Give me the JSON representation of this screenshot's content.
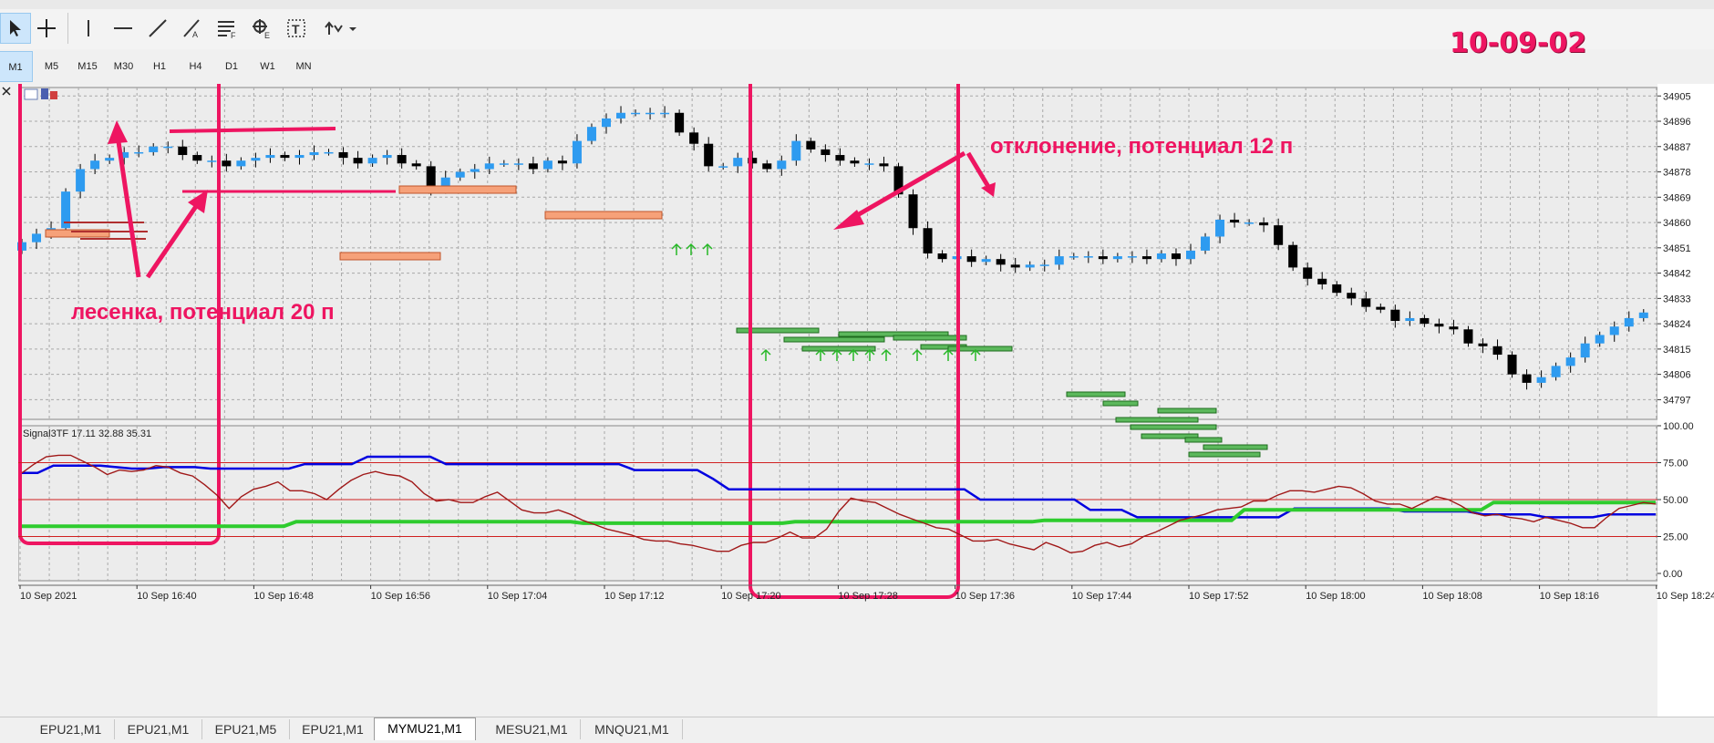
{
  "toolbar": {
    "tools": [
      {
        "icon": "cursor-icon",
        "label": "Cursor"
      },
      {
        "icon": "crosshair-icon",
        "label": "Crosshair"
      },
      {
        "icon": "vertical-line-icon",
        "label": "Vertical Line"
      },
      {
        "icon": "horizontal-line-icon",
        "label": "Horizontal Line"
      },
      {
        "icon": "trendline-icon",
        "label": "Trendline"
      },
      {
        "icon": "trendline-angle-icon",
        "label": "Trendline by Angle"
      },
      {
        "icon": "fibonacci-icon",
        "label": "Fibonacci"
      },
      {
        "icon": "gann-icon",
        "label": "Gann"
      },
      {
        "icon": "text-icon",
        "label": "Text"
      },
      {
        "icon": "arrows-icon",
        "label": "Arrows"
      }
    ]
  },
  "timeframes": [
    "M1",
    "M5",
    "M15",
    "M30",
    "H1",
    "H4",
    "D1",
    "W1",
    "MN"
  ],
  "active_timeframe": "M1",
  "annotation_title": "10-09-02",
  "annotations": {
    "ladder": "лесенка, потенциал 20 п",
    "deviation": "отклонение, потенциал 12 п"
  },
  "tabs": [
    "EPU21,M1",
    "EPU21,M1",
    "EPU21,M5",
    "EPU21,M1",
    "MYMU21,M1",
    "MESU21,M1",
    "MNQU21,M1"
  ],
  "active_tab": "MYMU21,M1",
  "colors": {
    "bull": "#2e9bf0",
    "bear": "#000000",
    "grid": "#a8a8a8",
    "accent": "#ee1561",
    "bg": "#ececec"
  },
  "chart_data": [
    {
      "type": "candlestick",
      "xlabel": "",
      "ylabel": "",
      "x_ticks": [
        "10 Sep 2021",
        "10 Sep 16:40",
        "10 Sep 16:48",
        "10 Sep 16:56",
        "10 Sep 17:04",
        "10 Sep 17:12",
        "10 Sep 17:20",
        "10 Sep 17:28",
        "10 Sep 17:36",
        "10 Sep 17:44",
        "10 Sep 17:52",
        "10 Sep 18:00",
        "10 Sep 18:08",
        "10 Sep 18:16",
        "10 Sep 18:24"
      ],
      "y_ticks": [
        34905,
        34896,
        34887,
        34878,
        34869,
        34860,
        34851,
        34842,
        34833,
        34824,
        34815,
        34806,
        34797
      ],
      "ylim": [
        34790,
        34908
      ],
      "closes": [
        34853,
        34856,
        34858,
        34871,
        34879,
        34882,
        34883,
        34885,
        34885,
        34887,
        34887,
        34884,
        34882,
        34882,
        34880,
        34882,
        34883,
        34884,
        34883,
        34884,
        34885,
        34885,
        34883,
        34881,
        34883,
        34884,
        34881,
        34880,
        34872,
        34876,
        34878,
        34879,
        34881,
        34881,
        34881,
        34879,
        34882,
        34881,
        34889,
        34894,
        34897,
        34899,
        34899,
        34899,
        34899,
        34892,
        34888,
        34880,
        34880,
        34883,
        34881,
        34879,
        34882,
        34889,
        34886,
        34884,
        34882,
        34881,
        34881,
        34880,
        34870,
        34858,
        34849,
        34847,
        34848,
        34846,
        34847,
        34845,
        34844,
        34845,
        34845,
        34848,
        34848,
        34848,
        34847,
        34848,
        34848,
        34847,
        34849,
        34847,
        34850,
        34855,
        34861,
        34860,
        34860,
        34859,
        34852,
        34844,
        34840,
        34838,
        34835,
        34833,
        34830,
        34829,
        34825,
        34826,
        34824,
        34823,
        34822,
        34817,
        34816,
        34813,
        34806,
        34803,
        34805,
        34809,
        34812,
        34817,
        34820,
        34823,
        34826,
        34828,
        34827,
        34826,
        34824,
        34825,
        34825,
        34824,
        34823,
        34824,
        34822,
        34824,
        34828,
        34828,
        34826,
        34825,
        34824,
        34823,
        34822,
        34820,
        34817,
        34815,
        34814,
        34811,
        34804,
        34811,
        34815,
        34819,
        34823
      ],
      "up_arrows_times": [
        "10 Sep 17:13",
        "10 Sep 17:14",
        "10 Sep 17:15",
        "10 Sep 17:21",
        "10 Sep 17:24",
        "10 Sep 17:25",
        "10 Sep 17:26",
        "10 Sep 17:27",
        "10 Sep 17:28",
        "10 Sep 17:30",
        "10 Sep 17:32",
        "10 Sep 17:34"
      ]
    },
    {
      "type": "line",
      "title": "Signal3TF 17.11 32.88 35.31",
      "y_ticks": [
        100,
        75,
        50,
        25,
        0
      ],
      "ylim": [
        0,
        100
      ],
      "levels": [
        75,
        50,
        25
      ],
      "series": [
        {
          "color": "#0000e0",
          "values": [
            68,
            68,
            73,
            73,
            73,
            73,
            72,
            71,
            71,
            72,
            72,
            72,
            71,
            71,
            71,
            71,
            71,
            71,
            74,
            74,
            74,
            74,
            79,
            79,
            79,
            79,
            79,
            74,
            74,
            74,
            74,
            74,
            74,
            74,
            74,
            74,
            74,
            74,
            74,
            70,
            70,
            70,
            70,
            70,
            64,
            57,
            57,
            57,
            57,
            57,
            57,
            57,
            57,
            57,
            57,
            57,
            57,
            57,
            57,
            57,
            57,
            50,
            50,
            50,
            50,
            50,
            50,
            50,
            43,
            43,
            43,
            38,
            38,
            38,
            38,
            38,
            38,
            38,
            38,
            38,
            38,
            44,
            44,
            44,
            44,
            44,
            44,
            44,
            42,
            42,
            42,
            42,
            42,
            40,
            40,
            40,
            40,
            38,
            38,
            38,
            38,
            40,
            40,
            40,
            40
          ]
        },
        {
          "color": "#2ecc2e",
          "values": [
            32,
            32,
            32,
            32,
            32,
            32,
            32,
            32,
            32,
            32,
            32,
            32,
            32,
            32,
            32,
            32,
            32,
            32,
            32,
            32,
            32,
            32,
            35,
            35,
            35,
            35,
            35,
            35,
            35,
            35,
            35,
            35,
            35,
            35,
            35,
            35,
            35,
            35,
            35,
            35,
            35,
            35,
            35,
            35,
            35,
            34,
            34,
            34,
            34,
            34,
            34,
            34,
            34,
            34,
            34,
            34,
            34,
            34,
            34,
            34,
            34,
            34,
            35,
            35,
            35,
            35,
            35,
            35,
            35,
            35,
            35,
            35,
            35,
            35,
            35,
            35,
            35,
            35,
            35,
            35,
            35,
            35,
            36,
            36,
            36,
            36,
            36,
            36,
            36,
            36,
            36,
            36,
            36,
            36,
            36,
            36,
            36,
            36,
            43,
            43,
            43,
            43,
            43,
            43,
            43,
            43,
            43,
            43,
            43,
            43,
            43,
            43,
            43,
            43,
            43,
            43,
            43,
            43,
            48,
            48,
            48,
            48,
            48,
            48,
            48,
            48,
            48,
            48,
            48,
            48,
            48,
            48
          ]
        },
        {
          "color": "#a01818",
          "values": [
            68,
            74,
            79,
            80,
            80,
            76,
            72,
            67,
            70,
            69,
            70,
            73,
            72,
            68,
            66,
            60,
            53,
            44,
            52,
            57,
            59,
            62,
            56,
            56,
            54,
            50,
            57,
            63,
            67,
            69,
            67,
            66,
            62,
            54,
            49,
            50,
            48,
            48,
            52,
            55,
            49,
            43,
            41,
            41,
            43,
            40,
            36,
            33,
            30,
            28,
            26,
            23,
            22,
            22,
            20,
            19,
            17,
            15,
            15,
            19,
            21,
            21,
            24,
            28,
            24,
            24,
            30,
            42,
            51,
            49,
            48,
            44,
            40,
            37,
            34,
            31,
            30,
            26,
            22,
            22,
            23,
            20,
            18,
            16,
            21,
            18,
            14,
            15,
            19,
            21,
            18,
            20,
            25,
            28,
            32,
            36,
            38,
            40,
            43,
            44,
            45,
            49,
            49,
            53,
            56,
            56,
            55,
            57,
            59,
            58,
            54,
            49,
            47,
            47,
            44,
            48,
            52,
            50,
            46,
            41,
            39,
            40,
            38,
            37,
            35,
            38,
            36,
            34,
            31,
            31,
            38,
            44,
            46,
            48,
            47
          ]
        }
      ]
    }
  ]
}
